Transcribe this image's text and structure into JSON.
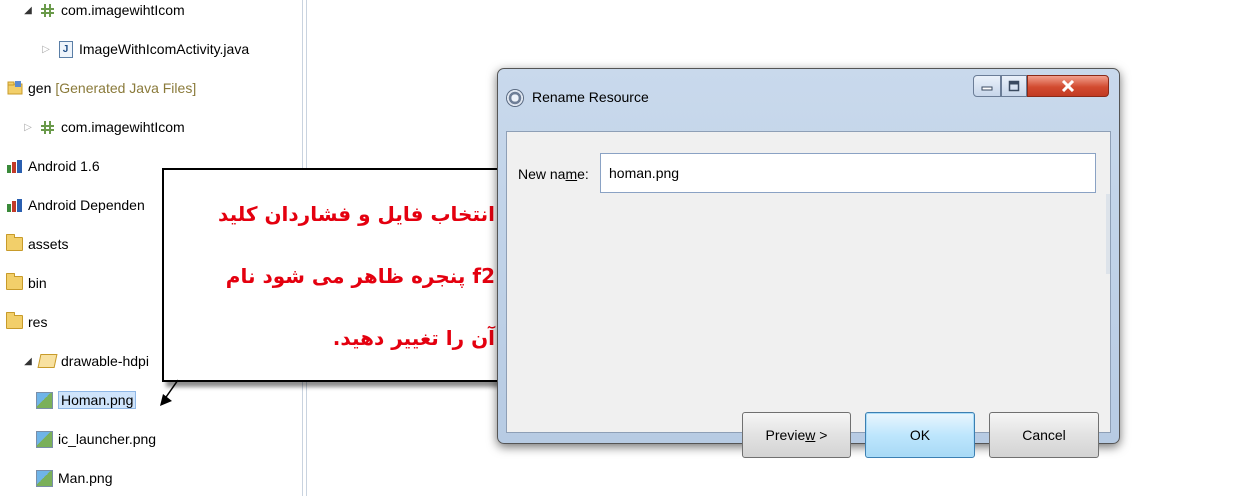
{
  "tree": {
    "items": [
      {
        "twisty": "open",
        "icon": "package-icon",
        "label": "com.imagewihtIcom",
        "deco": ""
      },
      {
        "twisty": "closed",
        "icon": "java-file-icon",
        "label": "ImageWithIcomActivity.java",
        "deco": ""
      },
      {
        "twisty": "",
        "icon": "generated-folder-icon",
        "label": "gen",
        "deco": "[Generated Java Files]"
      },
      {
        "twisty": "closed",
        "icon": "package-icon",
        "label": "com.imagewihtIcom",
        "deco": ""
      },
      {
        "twisty": "",
        "icon": "library-icon",
        "label": "Android 1.6",
        "deco": ""
      },
      {
        "twisty": "",
        "icon": "library-icon",
        "label": "Android Dependen",
        "deco": ""
      },
      {
        "twisty": "",
        "icon": "folder-icon",
        "label": "assets",
        "deco": ""
      },
      {
        "twisty": "",
        "icon": "folder-icon",
        "label": "bin",
        "deco": ""
      },
      {
        "twisty": "",
        "icon": "folder-icon",
        "label": "res",
        "deco": ""
      },
      {
        "twisty": "open",
        "icon": "open-folder-icon",
        "label": "drawable-hdpi",
        "deco": ""
      },
      {
        "twisty": "",
        "icon": "image-file-icon",
        "label": "Homan.png",
        "deco": ""
      },
      {
        "twisty": "",
        "icon": "image-file-icon",
        "label": "ic_launcher.png",
        "deco": ""
      },
      {
        "twisty": "",
        "icon": "image-file-icon",
        "label": "Man.png",
        "deco": ""
      }
    ]
  },
  "callout": {
    "lines": [
      "انتخاب فایل و فشاردان کلید",
      "f2 پنجره  ظاهر می شود نام",
      "آن را تغییر دهید."
    ],
    "text_color": "#e4000f"
  },
  "dialog": {
    "title": "Rename Resource",
    "icon": "eclipse-gear-icon",
    "new_name_label": "New name:",
    "new_name_value": "homan.png",
    "preview_button": "Preview >",
    "ok_button": "OK",
    "cancel_button": "Cancel",
    "minimize_icon": "minimize-icon",
    "maximize_icon": "maximize-icon",
    "close_icon": "close-icon"
  }
}
